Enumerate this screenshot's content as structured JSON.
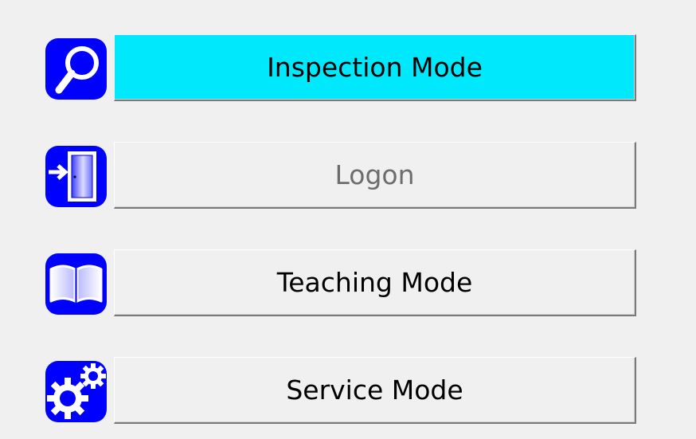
{
  "colors": {
    "background": "#f0f0f0",
    "icon_blue": "#0000ff",
    "active_button": "#00e8fc",
    "disabled_text": "#6d6d6d"
  },
  "menu": {
    "items": [
      {
        "label": "Inspection Mode",
        "icon": "magnifier-icon",
        "state": "active"
      },
      {
        "label": "Logon",
        "icon": "door-icon",
        "state": "disabled"
      },
      {
        "label": "Teaching Mode",
        "icon": "book-icon",
        "state": "normal"
      },
      {
        "label": "Service Mode",
        "icon": "gears-icon",
        "state": "normal"
      }
    ]
  }
}
